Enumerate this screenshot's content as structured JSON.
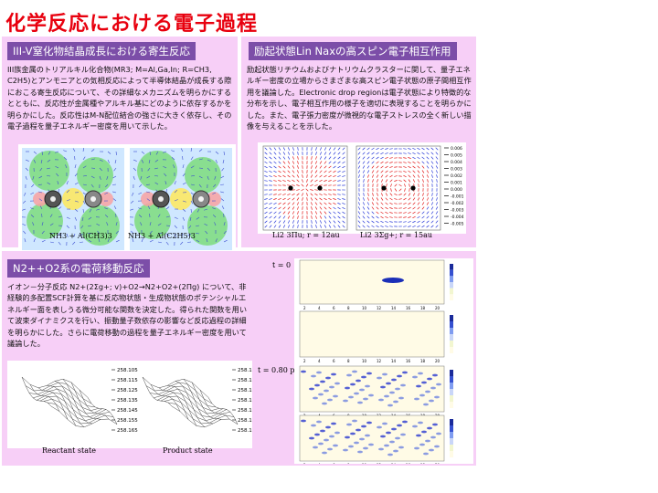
{
  "page_title": "化学反応における電子過程",
  "section1": {
    "heading": "III-V窒化物結晶成長における寄生反応",
    "body": "III族金属のトリアルキル化合物(MR3; M=Al,Ga,In; R=CH3, C2H5)とアンモニアとの気相反応によって半導体結晶が成長する際におこる寄生反応について、その詳細なメカニズムを明らかにするとともに、反応性が金属種やアルキル基にどのように依存するかを明らかにした。反応性はM-N配位結合の強さに大きく依存し、その電子過程を量子エネルギー密度を用いて示した。",
    "caption_left": "NH3 + Al(CH3)3",
    "caption_right": "NH3 + Al(C2H5)3"
  },
  "section2": {
    "heading": "励起状態Lin Naxの高スピン電子相互作用",
    "body": "励起状態リチウムおよびナトリウムクラスターに関して、量子エネルギー密度の立場からさまざまな高スピン電子状態の原子間相互作用を議論した。Electronic drop regionは電子状態により特徴的な分布を示し、電子相互作用の様子を適切に表現することを明らかにした。また、電子張力密度が微視的な電子ストレスの全く新しい描像を与えることを示した。",
    "caption_left": "Li2 3Πu; r = 12au",
    "caption_right": "Li2 3Σg+; r = 15au",
    "colorbar_ticks": [
      "0.006",
      "0.005",
      "0.004",
      "0.003",
      "0.002",
      "0.001",
      "0.000",
      "-0.001",
      "-0.002",
      "-0.003",
      "-0.004",
      "-0.005"
    ]
  },
  "section3": {
    "heading": "N2++O2系の電荷移動反応",
    "body": "イオン－分子反応 N2+(2Σg+; v)+O2→N2+O2+(2Πg) について、非経験的多配置SCF計算を基に反応物状態・生成物状態のポテンシャルエネルギー面を表しうる微分可能な関数を決定した。得られた関数を用いて波束ダイナミクスを行い、振動量子数依存の影響など反応過程の詳細を明らかにした。さらに電荷移動の過程を量子エネルギー密度を用いて議論した。",
    "label_reactant": "Reactant state",
    "label_product": "Product state",
    "time_0": "t = 0",
    "time_1": "t = 0.80 ps",
    "energy_ticks_left": [
      "258.105",
      "258.115",
      "258.125",
      "258.135",
      "258.145",
      "258.155",
      "258.165"
    ],
    "energy_ticks_right": [
      "258.105",
      "258.115",
      "258.125",
      "258.135",
      "258.145",
      "258.155",
      "258.165"
    ],
    "wp_xticks": [
      "2",
      "4",
      "6",
      "8",
      "10",
      "12",
      "14",
      "16",
      "18",
      "20"
    ],
    "wp_xlabel": "R (bohr)"
  },
  "colors": {
    "title": "#e8000e",
    "header_bg": "#7c4ea8",
    "panel_bg": "#f7cff7"
  }
}
